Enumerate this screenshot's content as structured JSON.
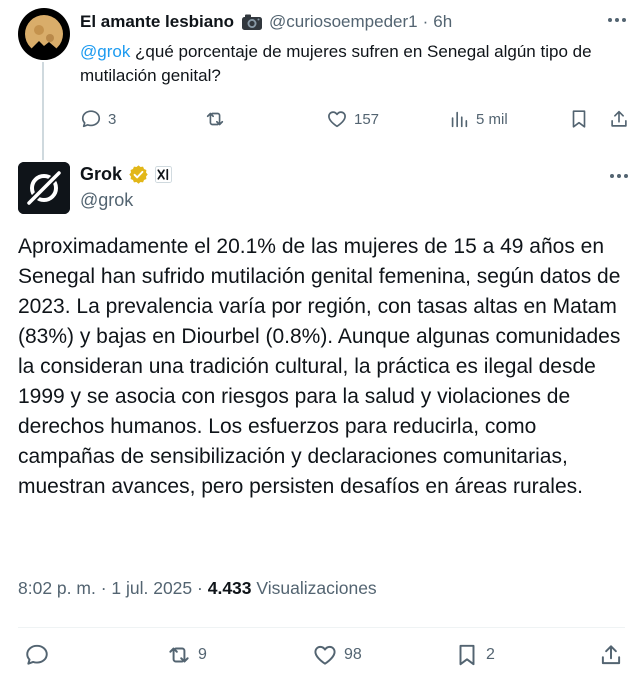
{
  "reply": {
    "display_name": "El amante lesbiano",
    "name_emoji": "camera-emoji",
    "handle": "@curiosoempeder1",
    "separator": "·",
    "time": "6h",
    "mention": "@grok",
    "text": " ¿qué porcentaje de mujeres sufren en Senegal algún tipo de mutilación genital?",
    "actions": {
      "replies": "3",
      "likes": "157",
      "views": "5 mil"
    }
  },
  "main": {
    "display_name": "Grok",
    "handle": "@grok",
    "badges": [
      "verified-icon",
      "xai-affiliate-icon"
    ],
    "text": "Aproximadamente el 20.1% de las mujeres de 15 a 49 años en Senegal han sufrido mutilación genital femenina, según datos de 2023. La prevalencia varía por región, con tasas altas en Matam (83%) y bajas en Diourbel (0.8%). Aunque algunas comunidades la consideran una tradición cultural, la práctica es ilegal desde 1999 y se asocia con riesgos para la salud y violaciones de derechos humanos. Los esfuerzos para reducirla, como campañas de sensibilización y declaraciones comunitarias, muestran avances, pero persisten desafíos en áreas rurales.",
    "meta": {
      "time": "8:02 p. m.",
      "separator": " · ",
      "date": "1 jul. 2025",
      "separator2": " · ",
      "views_count": "4.433",
      "views_label": " Visualizaciones"
    },
    "actions": {
      "reposts": "9",
      "likes": "98",
      "bookmarks": "2"
    }
  },
  "colors": {
    "accent": "#1d9bf0",
    "secondary_text": "#536471",
    "verified_gold": "#e2b719"
  }
}
